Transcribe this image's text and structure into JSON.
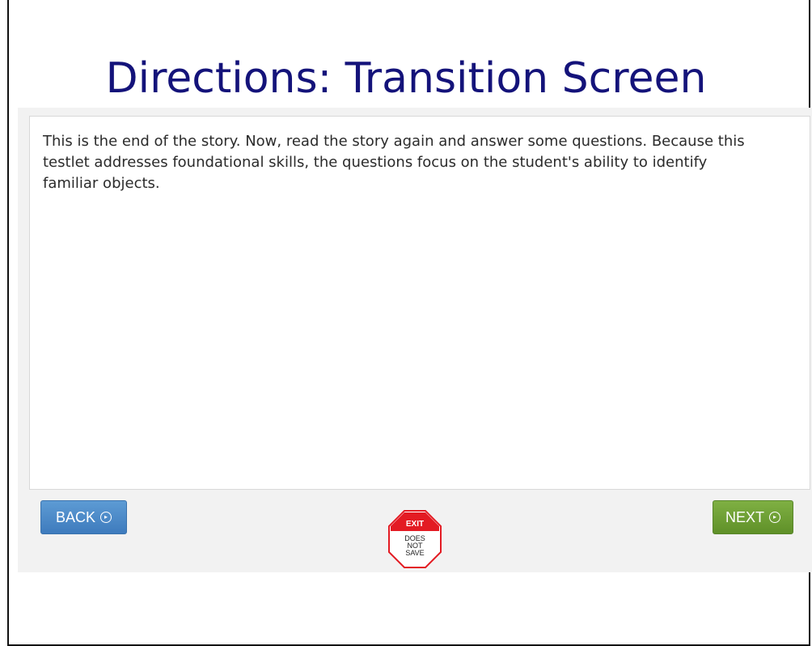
{
  "slide": {
    "title": "Directions: Transition Screen"
  },
  "content": {
    "text": "This is the end of the story. Now, read the story again and answer some questions. Because this testlet addresses foundational skills, the questions focus on the student's ability to identify familiar objects."
  },
  "buttons": {
    "back_label": "BACK",
    "next_label": "NEXT",
    "back_color": "#4a8cc9",
    "next_color": "#6e9e34"
  },
  "exit": {
    "label": "EXIT",
    "sub": "DOES\nNOT\nSAVE",
    "color": "#e31b23"
  }
}
